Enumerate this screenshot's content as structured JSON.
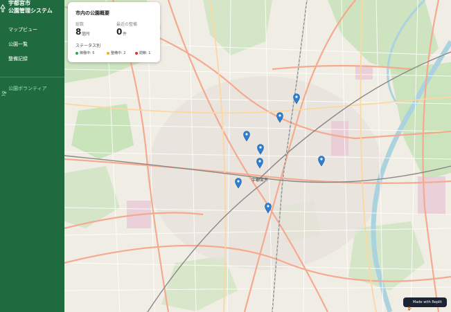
{
  "sidebar": {
    "brand_line1": "宇都宮市",
    "brand_line2": "公園管理システム",
    "brand_icon": "park-sign-icon",
    "nav": [
      {
        "label": "マップビュー"
      },
      {
        "label": "公園一覧"
      },
      {
        "label": "整備記録"
      }
    ],
    "volunteer": {
      "label": "公園ボランティア",
      "icon": "people-icon"
    },
    "colors": {
      "background": "#1f6b3f",
      "accent": "#9fe3b8"
    }
  },
  "summary": {
    "title": "市内の公園概要",
    "total_label": "総数",
    "total_value": "8",
    "total_unit": "箇所",
    "recent_label": "最近の整備",
    "recent_value": "0",
    "recent_unit": "件",
    "status_heading": "ステータス別",
    "statuses": [
      {
        "label": "稼働中: 5",
        "color": "#22a84a"
      },
      {
        "label": "整備中: 2",
        "color": "#f2b01e"
      },
      {
        "label": "閉鎖: 1",
        "color": "#e03131"
      }
    ]
  },
  "map": {
    "station_label": "宇都宮市",
    "pin_color": "#2f7fd0",
    "pin_count": 8
  },
  "badge": {
    "label": "Made with Replit",
    "icon": "replit-icon"
  }
}
